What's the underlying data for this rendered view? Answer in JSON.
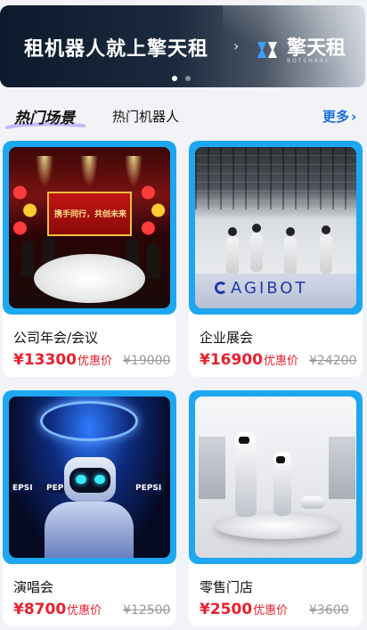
{
  "banner": {
    "slogan": "租机器人就上擎天租",
    "arrow": "›",
    "brand_name": "擎天租",
    "brand_en": "BOTSHARE",
    "page_count": 2,
    "active_index": 0
  },
  "tabs": {
    "active_label": "热门场景",
    "second_label": "热门机器人",
    "more_label": "更多"
  },
  "cards": [
    {
      "title": "公司年会/会议",
      "price": "¥13300",
      "price_tag": "优惠价",
      "original": "¥19000",
      "image": "gala-dinner-stage"
    },
    {
      "title": "企业展会",
      "price": "¥16900",
      "price_tag": "优惠价",
      "original": "¥24200",
      "image": "expo-booth-robots"
    },
    {
      "title": "演唱会",
      "price": "¥8700",
      "price_tag": "优惠价",
      "original": "¥12500",
      "image": "concert-robot"
    },
    {
      "title": "零售门店",
      "price": "¥2500",
      "price_tag": "优惠价",
      "original": "¥3600",
      "image": "retail-mall-robots"
    }
  ],
  "scene_text": {
    "gala_screen": "携手同行，共创未来",
    "expo_brand": "AGIBOT",
    "concert_sign_a": "EPSI",
    "concert_sign_b": "PEPSI",
    "concert_sign_c": "PEPSI"
  },
  "colors": {
    "accent_blue": "#1a6fe0",
    "price_red": "#e8202e",
    "card_frame": "#1da7f0"
  }
}
